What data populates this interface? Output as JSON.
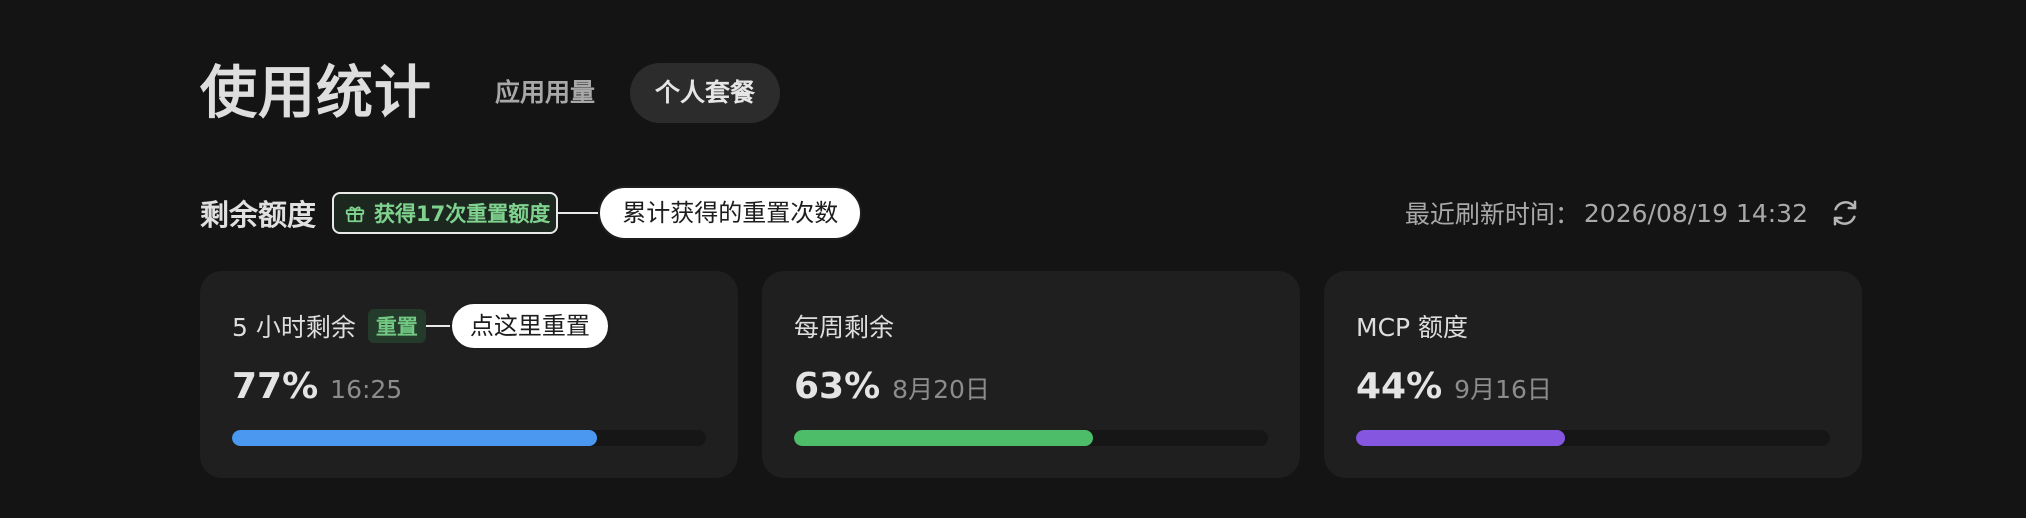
{
  "header": {
    "title": "使用统计",
    "tabs": [
      {
        "label": "应用用量",
        "active": false
      },
      {
        "label": "个人套餐",
        "active": true
      }
    ]
  },
  "quota": {
    "title": "剩余额度",
    "reward_badge": "获得17次重置额度",
    "reward_callout": "累计获得的重置次数",
    "refresh_label": "最近刷新时间：",
    "refresh_time": "2026/08/19 14:32"
  },
  "cards": [
    {
      "title": "5 小时剩余",
      "reset_tag": "重置",
      "reset_callout": "点这里重置",
      "percent": "77%",
      "reset_at": "16:25",
      "fill": 0.77,
      "color": "#4a98f0"
    },
    {
      "title": "每周剩余",
      "percent": "63%",
      "reset_at": "8月20日",
      "fill": 0.63,
      "color": "#4ebd6a"
    },
    {
      "title": "MCP 额度",
      "percent": "44%",
      "reset_at": "9月16日",
      "fill": 0.44,
      "color": "#8557e0"
    }
  ],
  "icons": {
    "gift": "gift-icon",
    "refresh": "refresh-icon"
  }
}
